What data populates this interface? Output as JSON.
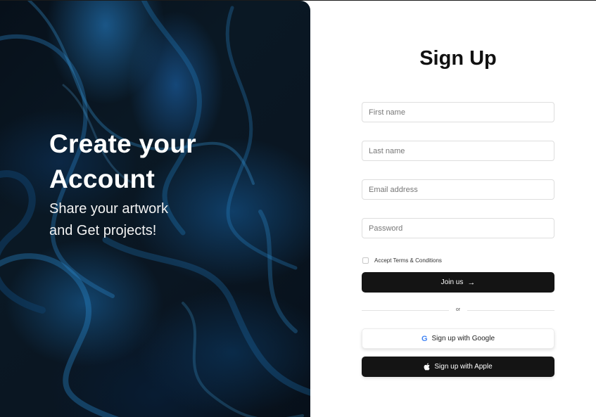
{
  "hero": {
    "title_line1": "Create your",
    "title_line2": "Account",
    "subtitle_line1": "Share your artwork",
    "subtitle_line2": "and Get projects!"
  },
  "form": {
    "title": "Sign Up",
    "first_name": {
      "value": "",
      "placeholder": "First name"
    },
    "last_name": {
      "value": "",
      "placeholder": "Last name"
    },
    "email": {
      "value": "",
      "placeholder": "Email address"
    },
    "password": {
      "value": "",
      "placeholder": "Password"
    },
    "terms_checked": false,
    "terms_label": "Accept Terms & Conditions",
    "join_label": "Join us",
    "join_icon": "arrow-right-icon",
    "divider_label": "or",
    "google_label": "Sign up with Google",
    "google_icon": "google-icon",
    "apple_label": "Sign up with Apple",
    "apple_icon": "apple-icon"
  },
  "colors": {
    "button_dark": "#141414",
    "google_blue": "#4285f4",
    "hero_accent": "#1e6fb0"
  }
}
